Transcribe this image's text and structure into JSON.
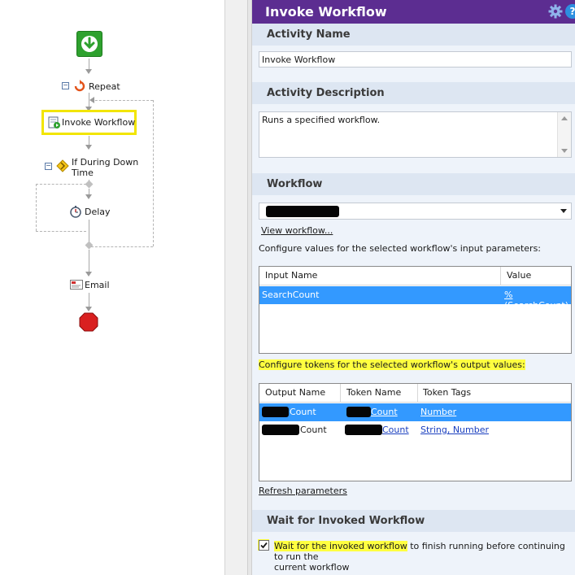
{
  "canvas": {
    "nodes": {
      "repeat": "Repeat",
      "invoke": "Invoke Workflow",
      "if_during_line1": "If During Down",
      "if_during_line2": "Time",
      "delay": "Delay",
      "email": "Email"
    },
    "selection_color": "#f2e500"
  },
  "panel": {
    "title": "Invoke Workflow",
    "header_color": "#5c2d91",
    "activity_name": {
      "heading": "Activity Name",
      "value": "Invoke Workflow"
    },
    "activity_description": {
      "heading": "Activity Description",
      "value": "Runs a specified workflow."
    },
    "workflow": {
      "heading": "Workflow",
      "selected": "",
      "view_link": "View workflow...",
      "input_caption": "Configure values for the selected workflow's input parameters:",
      "input_grid": {
        "headers": [
          "Input Name",
          "Value"
        ],
        "rows": [
          {
            "name": "SearchCount",
            "value": "%(SearchCount)"
          }
        ]
      },
      "output_caption": "Configure tokens for the selected workflow's output values:",
      "output_grid": {
        "headers": [
          "Output Name",
          "Token Name",
          "Token Tags"
        ],
        "rows": [
          {
            "output_suffix": "Count",
            "token_suffix": "Count",
            "tags": "Number"
          },
          {
            "output_suffix": "Count",
            "token_suffix": "Count",
            "tags": "String, Number"
          }
        ]
      },
      "refresh_link": "Refresh parameters"
    },
    "wait": {
      "heading": "Wait for Invoked Workflow",
      "checked": true,
      "label_part1": "Wait for the invoked workflow",
      "label_part2": " to finish running before continuing to run the",
      "label_line2": "current workflow"
    }
  }
}
